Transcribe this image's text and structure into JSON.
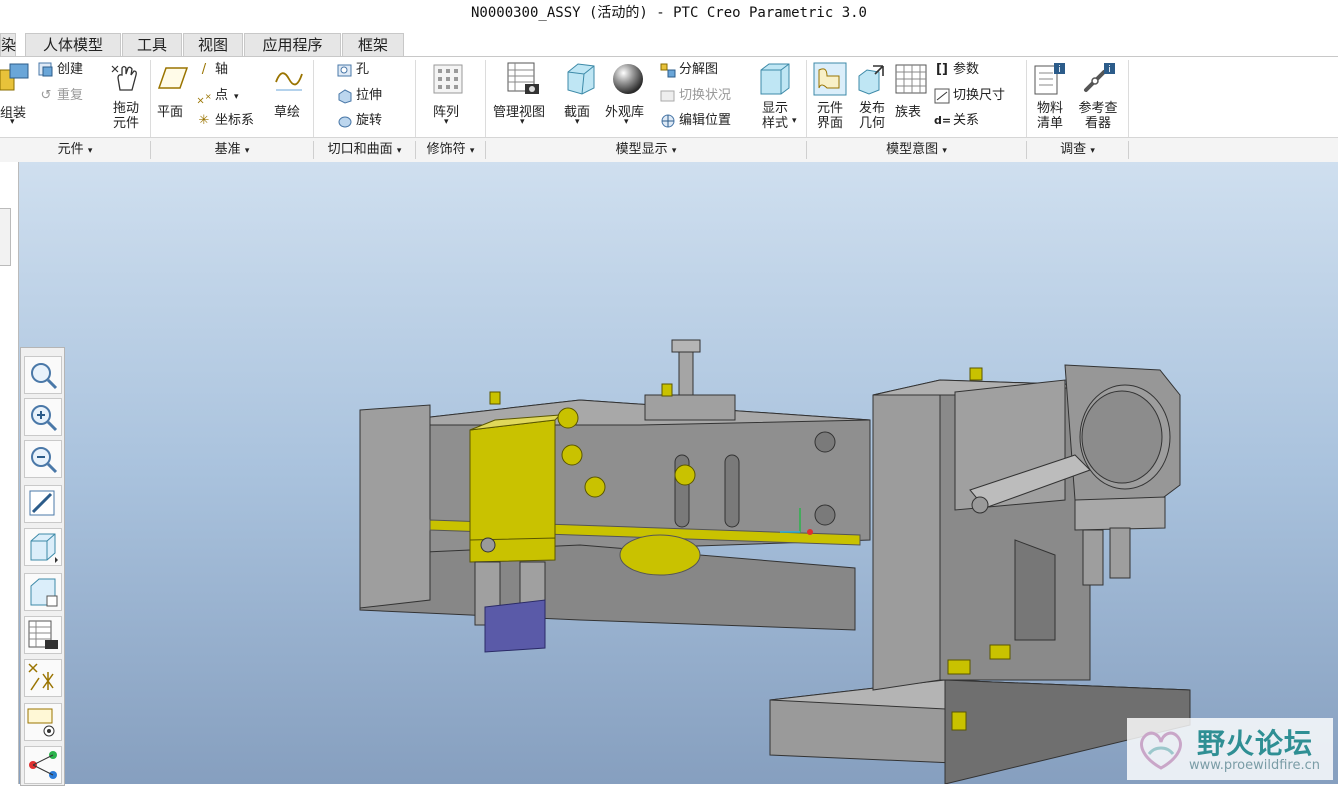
{
  "window": {
    "title": "N0000300_ASSY (活动的) - PTC Creo Parametric 3.0"
  },
  "tabs": [
    {
      "label": "染"
    },
    {
      "label": "人体模型"
    },
    {
      "label": "工具"
    },
    {
      "label": "视图"
    },
    {
      "label": "应用程序"
    },
    {
      "label": "框架"
    }
  ],
  "ribbon": {
    "assemble": "组装",
    "create": "创建",
    "repeat": "重复",
    "drag_line1": "拖动",
    "drag_line2": "元件",
    "plane": "平面",
    "axis": "轴",
    "point": "点",
    "csys": "坐标系",
    "sketch": "草绘",
    "hole": "孔",
    "extrude": "拉伸",
    "revolve": "旋转",
    "pattern": "阵列",
    "manage_views": "管理视图",
    "section": "截面",
    "appearance": "外观库",
    "explode": "分解图",
    "toggle_status": "切换状况",
    "edit_position": "编辑位置",
    "display_line1": "显示",
    "display_line2": "样式",
    "comp_iface_line1": "元件",
    "comp_iface_line2": "界面",
    "publish_line1": "发布",
    "publish_line2": "几何",
    "family_table": "族表",
    "parameters": "参数",
    "switch_dims": "切换尺寸",
    "relations": "关系",
    "bom_line1": "物料",
    "bom_line2": "清单",
    "ref_line1": "参考查",
    "ref_line2": "看器"
  },
  "groups": {
    "component": "元件",
    "datum": "基准",
    "cut_surface": "切口和曲面",
    "modifiers": "修饰符",
    "model_display": "模型显示",
    "model_intent": "模型意图",
    "investigate": "调查"
  },
  "watermark": {
    "title": "野火论坛",
    "url": "www.proewildfire.cn"
  },
  "colors": {
    "background_top": "#cfdfef",
    "background_bottom": "#869fbf",
    "part_gray": "#8e8e8e",
    "part_yellow": "#c9c200",
    "part_blue": "#5a5aa8",
    "watermark": "#2f8f94"
  }
}
